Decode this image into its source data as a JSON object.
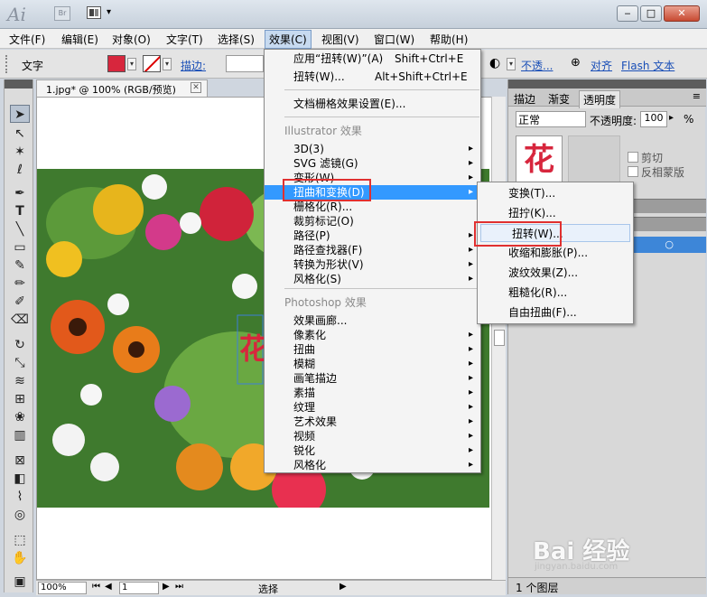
{
  "titlebar": {
    "app_logo": "Ai",
    "bridge_label": "Br",
    "window_buttons": [
      "‒",
      "□",
      "✕"
    ]
  },
  "menubar": {
    "items": [
      "文件(F)",
      "编辑(E)",
      "对象(O)",
      "文字(T)",
      "选择(S)",
      "效果(C)",
      "视图(V)",
      "窗口(W)",
      "帮助(H)"
    ],
    "active_index": 5
  },
  "controlbar": {
    "tool_label": "文字",
    "stroke_label": "描边:",
    "opacity_link": "不透...",
    "align_link": "对齐",
    "flash_link": "Flash 文本",
    "fill_color": "#d7263d"
  },
  "document": {
    "tab_title": "1.jpg* @ 100% (RGB/预览)",
    "zoom": "100%",
    "page": "1",
    "status_mode": "选择",
    "artwork_glyph": "花"
  },
  "effect_menu": {
    "apply_last": "应用“扭转(W)”(A)",
    "apply_last_shortcut": "Shift+Ctrl+E",
    "last_effect": "扭转(W)...",
    "last_effect_shortcut": "Alt+Shift+Ctrl+E",
    "raster_settings": "文档栅格效果设置(E)...",
    "illustrator_header": "Illustrator 效果",
    "illustrator_items": [
      "3D(3)",
      "SVG 滤镜(G)",
      "变形(W)",
      "扭曲和变换(D)",
      "栅格化(R)...",
      "裁剪标记(O)",
      "路径(P)",
      "路径查找器(F)",
      "转换为形状(V)",
      "风格化(S)"
    ],
    "illustrator_arrows": [
      true,
      true,
      true,
      true,
      false,
      false,
      true,
      true,
      true,
      true
    ],
    "photoshop_header": "Photoshop 效果",
    "photoshop_items": [
      "效果画廊...",
      "像素化",
      "扭曲",
      "模糊",
      "画笔描边",
      "素描",
      "纹理",
      "艺术效果",
      "视频",
      "锐化",
      "风格化"
    ],
    "photoshop_arrows": [
      false,
      true,
      true,
      true,
      true,
      true,
      true,
      true,
      true,
      true,
      true
    ],
    "highlighted_index": 3
  },
  "submenu": {
    "items": [
      "变换(T)...",
      "扭拧(K)...",
      "扭转(W)...",
      "收缩和膨胀(P)...",
      "波纹效果(Z)...",
      "粗糙化(R)...",
      "自由扭曲(F)..."
    ],
    "hover_index": 2
  },
  "right_panel": {
    "tabs": [
      "描边",
      "渐变",
      "透明度"
    ],
    "active_tab": 2,
    "blend_mode": "正常",
    "opacity_label": "不透明度:",
    "opacity_value": "100",
    "opacity_unit": "%",
    "checkbox_clip": "剪切",
    "checkbox_invert": "反相蒙版",
    "thumb_glyph": "花",
    "footer_layers": "1 个图层"
  },
  "watermark": {
    "brand": "Bai 经验",
    "url": "jingyan.baidu.com"
  }
}
